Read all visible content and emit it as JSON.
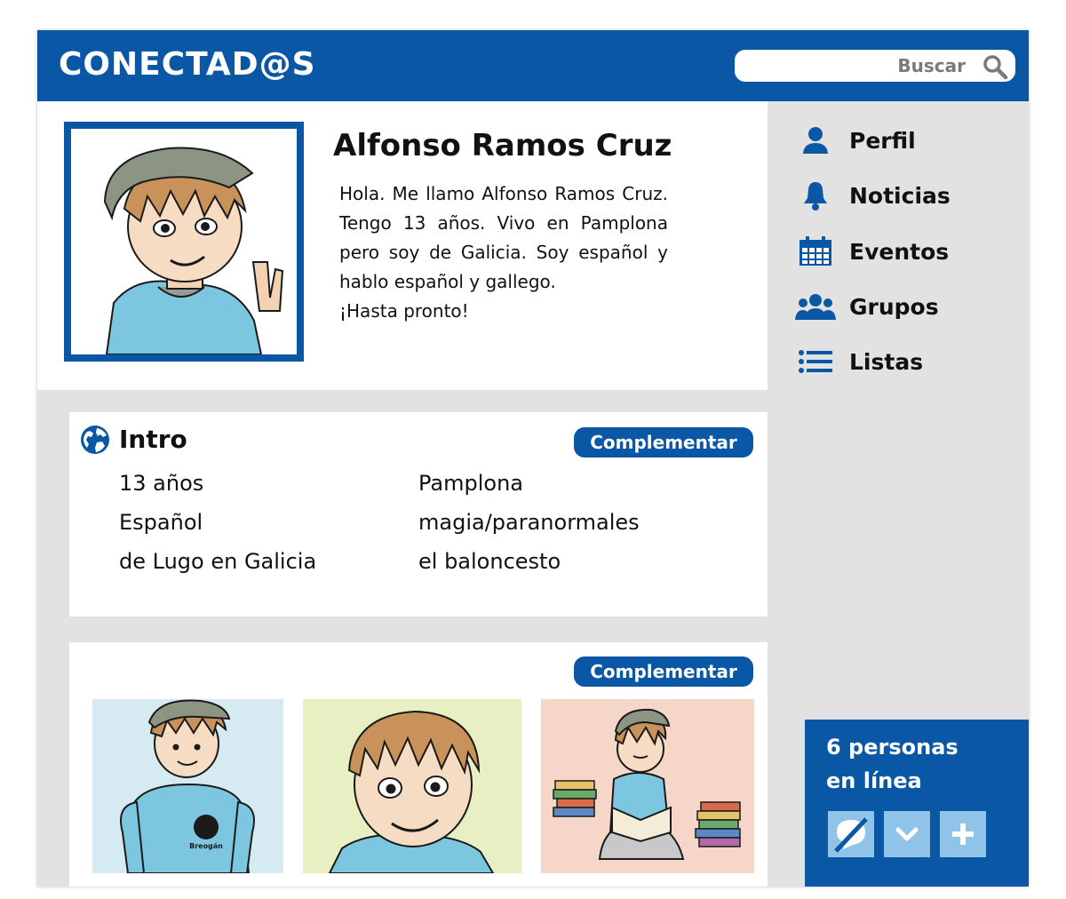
{
  "app": {
    "title": "CONECTAD@S"
  },
  "search": {
    "placeholder": "Buscar"
  },
  "profile": {
    "name": "Alfonso Ramos Cruz",
    "bio_lines": [
      "Hola. Me llamo Alfonso Ramos Cruz. Tengo 13 años. Vivo en Pamplona pero soy de Galicia. Soy español y hablo español y gallego.",
      "¡Hasta pronto!"
    ]
  },
  "sidebar": {
    "items": [
      {
        "label": "Perfil",
        "icon": "user-icon"
      },
      {
        "label": "Noticias",
        "icon": "bell-icon"
      },
      {
        "label": "Eventos",
        "icon": "calendar-icon"
      },
      {
        "label": "Grupos",
        "icon": "group-icon"
      },
      {
        "label": "Listas",
        "icon": "list-icon"
      }
    ]
  },
  "intro": {
    "title": "Intro",
    "button": "Complementar",
    "left": [
      "13 años",
      "Español",
      "de Lugo en Galicia"
    ],
    "right": [
      "Pamplona",
      "magia/paranormales",
      "el baloncesto"
    ]
  },
  "photos": {
    "button": "Complementar",
    "items": [
      {
        "shirt_text": "Breogán",
        "bg": "#d6ebf1"
      },
      {
        "bg": "#e8efc2"
      },
      {
        "bg": "#f6d6c8"
      }
    ]
  },
  "online": {
    "text_line1": "6 personas",
    "text_line2": "en línea",
    "buttons": [
      "chat-off-icon",
      "chevron-down-icon",
      "plus-icon"
    ]
  },
  "colors": {
    "brand": "#0a57a6",
    "panel": "#e2e2e2",
    "button_light": "#8fc3e8"
  }
}
